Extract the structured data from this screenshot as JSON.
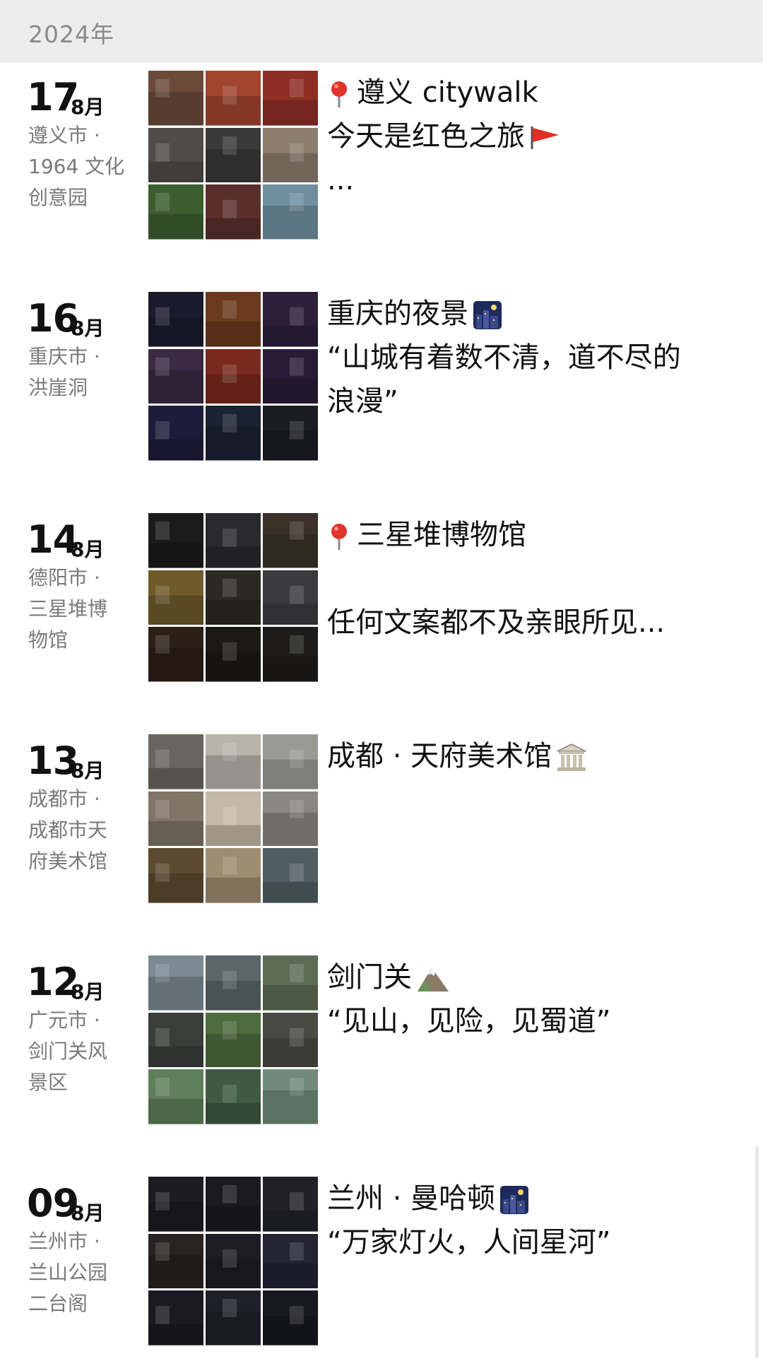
{
  "year_header": "2024年",
  "posts": [
    {
      "day": "17",
      "month": "8月",
      "location_lines": [
        "遵义市 ·",
        "1964 文化",
        "创意园"
      ],
      "text_lines": [
        "遵义 citywalk",
        "今天是红色之旅",
        "..."
      ],
      "icons": [
        "pin-icon",
        "red-flag-icon"
      ],
      "thumb_colors": [
        "#6b4a3a",
        "#a1452e",
        "#8f2e25",
        "#4f4b48",
        "#3a3a3a",
        "#8c7d6c",
        "#3c5e2f",
        "#5a2f2b",
        "#6f8f9f"
      ]
    },
    {
      "day": "16",
      "month": "8月",
      "location_lines": [
        "重庆市 ·",
        "洪崖洞"
      ],
      "text_lines": [
        "重庆的夜景",
        "“山城有着数不清，道不尽的",
        "浪漫”"
      ],
      "icons": [
        "night-city-icon"
      ],
      "thumb_colors": [
        "#1c1a2e",
        "#6b3a1c",
        "#2d1f3a",
        "#3a2a44",
        "#7a2a1c",
        "#2a1c38",
        "#1e1c3a",
        "#1a2233",
        "#1b1b24"
      ]
    },
    {
      "day": "14",
      "month": "8月",
      "location_lines": [
        "德阳市 ·",
        "三星堆博",
        "物馆"
      ],
      "text_lines": [
        "三星堆博物馆",
        "",
        "任何文案都不及亲眼所见..."
      ],
      "icons": [
        "pin-icon"
      ],
      "thumb_colors": [
        "#1b1b1b",
        "#2a2a2e",
        "#3a3228",
        "#6e5a2a",
        "#2a2a22",
        "#3b3a3e",
        "#2b1f16",
        "#1a1914",
        "#1d1c1a"
      ]
    },
    {
      "day": "13",
      "month": "8月",
      "location_lines": [
        "成都市 ·",
        "成都市天",
        "府美术馆"
      ],
      "text_lines": [
        "成都 · 天府美术馆"
      ],
      "icons": [
        "museum-icon"
      ],
      "thumb_colors": [
        "#6a6560",
        "#b8b3ab",
        "#9a9a95",
        "#7f7466",
        "#c4b8a6",
        "#8a8682",
        "#5e4a30",
        "#a08c70",
        "#4e5e63"
      ]
    },
    {
      "day": "12",
      "month": "8月",
      "location_lines": [
        "广元市 ·",
        "剑门关风",
        "景区"
      ],
      "text_lines": [
        "剑门关",
        "“见山，见险，见蜀道”"
      ],
      "icons": [
        "mountain-icon"
      ],
      "thumb_colors": [
        "#7c8a92",
        "#5a6668",
        "#5d6d55",
        "#3a3e3a",
        "#4e6b3e",
        "#4a4a44",
        "#5f7f5a",
        "#3e5a40",
        "#6f8a78"
      ]
    },
    {
      "day": "09",
      "month": "8月",
      "location_lines": [
        "兰州市 ·",
        "兰山公园",
        "二台阁"
      ],
      "text_lines": [
        "兰州 · 曼哈顿",
        "“万家灯火，人间星河”"
      ],
      "icons": [
        "night-city-icon"
      ],
      "thumb_colors": [
        "#1d1c22",
        "#1b1a20",
        "#22212a",
        "#2a2222",
        "#1e1d26",
        "#232331",
        "#1b1a22",
        "#20202a",
        "#181820"
      ]
    }
  ]
}
